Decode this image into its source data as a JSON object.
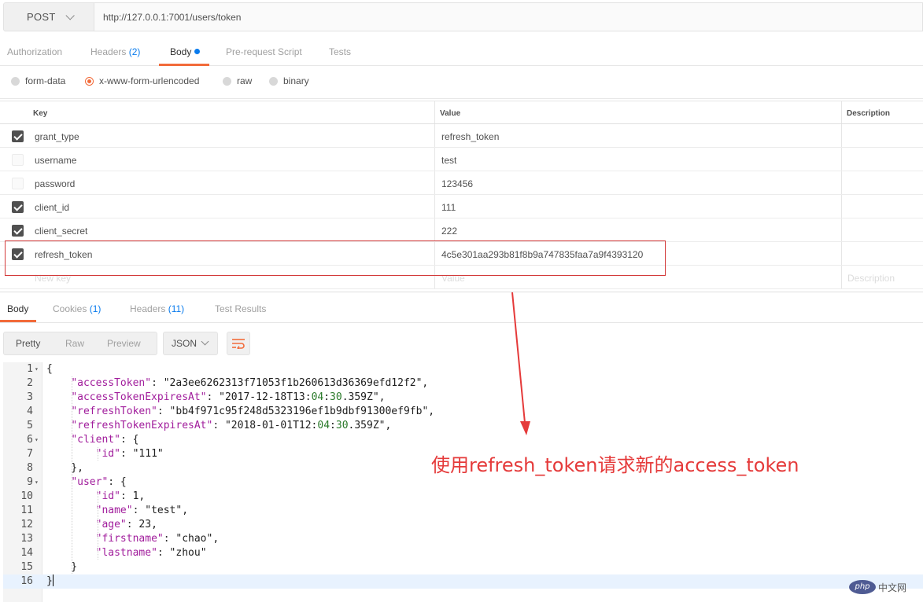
{
  "request": {
    "method": "POST",
    "url": "http://127.0.0.1:7001/users/token"
  },
  "request_tabs": [
    {
      "label": "Authorization",
      "count": ""
    },
    {
      "label": "Headers",
      "count": "(2)"
    },
    {
      "label": "Body",
      "count": ""
    },
    {
      "label": "Pre-request Script",
      "count": ""
    },
    {
      "label": "Tests",
      "count": ""
    }
  ],
  "body_types": [
    {
      "label": "form-data",
      "selected": false
    },
    {
      "label": "x-www-form-urlencoded",
      "selected": true
    },
    {
      "label": "raw",
      "selected": false
    },
    {
      "label": "binary",
      "selected": false
    }
  ],
  "kv_table": {
    "headers": {
      "key": "Key",
      "value": "Value",
      "description": "Description"
    },
    "rows": [
      {
        "key": "grant_type",
        "value": "refresh_token",
        "checked": true
      },
      {
        "key": "username",
        "value": "test",
        "checked": false
      },
      {
        "key": "password",
        "value": "123456",
        "checked": false
      },
      {
        "key": "client_id",
        "value": "111",
        "checked": true
      },
      {
        "key": "client_secret",
        "value": "222",
        "checked": true
      },
      {
        "key": "refresh_token",
        "value": "4c5e301aa293b81f8b9a747835faa7a9f4393120",
        "checked": true
      }
    ],
    "placeholder": {
      "key": "New key",
      "value": "Value",
      "description": "Description"
    }
  },
  "response_tabs": [
    {
      "label": "Body",
      "count": ""
    },
    {
      "label": "Cookies",
      "count": "(1)"
    },
    {
      "label": "Headers",
      "count": "(11)"
    },
    {
      "label": "Test Results",
      "count": ""
    }
  ],
  "view_modes": [
    "Pretty",
    "Raw",
    "Preview"
  ],
  "format": "JSON",
  "code_lines": [
    {
      "n": "1",
      "text": "{"
    },
    {
      "n": "2",
      "text": "    \"accessToken\": \"2a3ee6262313f71053f1b260613d36369efd12f2\","
    },
    {
      "n": "3",
      "text": "    \"accessTokenExpiresAt\": \"2017-12-18T13:04:30.359Z\","
    },
    {
      "n": "4",
      "text": "    \"refreshToken\": \"bb4f971c95f248d5323196ef1b9dbf91300ef9fb\","
    },
    {
      "n": "5",
      "text": "    \"refreshTokenExpiresAt\": \"2018-01-01T12:04:30.359Z\","
    },
    {
      "n": "6",
      "text": "    \"client\": {"
    },
    {
      "n": "7",
      "text": "        \"id\": \"111\""
    },
    {
      "n": "8",
      "text": "    },"
    },
    {
      "n": "9",
      "text": "    \"user\": {"
    },
    {
      "n": "10",
      "text": "        \"id\": 1,"
    },
    {
      "n": "11",
      "text": "        \"name\": \"test\","
    },
    {
      "n": "12",
      "text": "        \"age\": 23,"
    },
    {
      "n": "13",
      "text": "        \"firstname\": \"chao\","
    },
    {
      "n": "14",
      "text": "        \"lastname\": \"zhou\""
    },
    {
      "n": "15",
      "text": "    }"
    },
    {
      "n": "16",
      "text": "}"
    }
  ],
  "annotation": "使用refresh_token请求新的access_token",
  "watermark": {
    "logo": "php",
    "text": "中文网"
  },
  "colors": {
    "accent": "#f26b3a",
    "link": "#097bed",
    "annotation": "#e53a3a"
  }
}
